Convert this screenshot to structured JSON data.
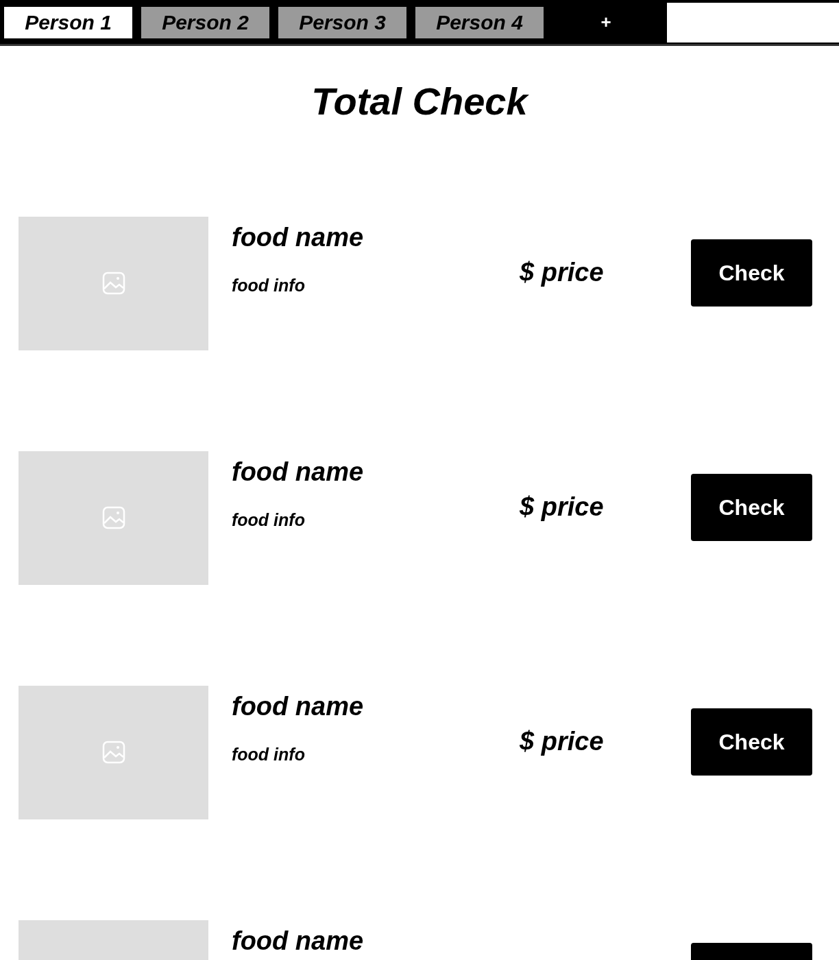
{
  "tabs": [
    {
      "label": "Person 1",
      "selected": true
    },
    {
      "label": "Person 2",
      "selected": false
    },
    {
      "label": "Person 3",
      "selected": false
    },
    {
      "label": "Person 4",
      "selected": false
    }
  ],
  "add_tab": "+",
  "title": "Total Check",
  "items": [
    {
      "kind": "picture",
      "name": "food name",
      "info": "food info",
      "price": "$ price",
      "button": "Check"
    },
    {
      "kind": "picture",
      "name": "food name",
      "info": "food info",
      "price": "$ price",
      "button": "Check"
    },
    {
      "kind": "picture",
      "name": "food name",
      "info": "food info",
      "price": "$ price",
      "button": "Check"
    },
    {
      "kind": "picture",
      "name": "food name"
    }
  ]
}
